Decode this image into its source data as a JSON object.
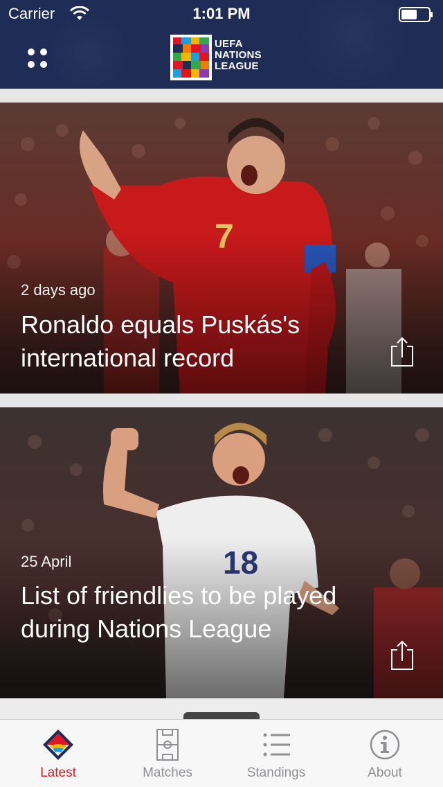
{
  "status_bar": {
    "carrier": "Carrier",
    "time": "1:01 PM"
  },
  "header": {
    "logo_line1": "UEFA",
    "logo_line2": "NATIONS",
    "logo_line3": "LEAGUE",
    "background_color": "#1f2c55"
  },
  "articles": [
    {
      "date": "2 days ago",
      "title": "Ronaldo equals Puskás's international record",
      "image": "footballer-celebrating-red-kit"
    },
    {
      "date": "25 April",
      "title": "List of friendlies to be played during Nations League",
      "image": "footballer-celebrating-white-kit"
    }
  ],
  "tabs": [
    {
      "label": "Latest",
      "icon": "nations-league-diamond-icon",
      "active": true
    },
    {
      "label": "Matches",
      "icon": "pitch-icon",
      "active": false
    },
    {
      "label": "Standings",
      "icon": "list-icon",
      "active": false
    },
    {
      "label": "About",
      "icon": "info-icon",
      "active": false
    }
  ],
  "colors": {
    "accent": "#e4151e",
    "tab_inactive": "#8e8e93"
  }
}
